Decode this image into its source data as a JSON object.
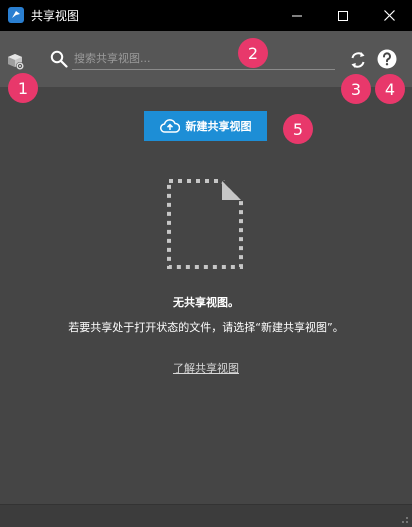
{
  "window": {
    "title": "共享视图"
  },
  "toolbar": {
    "search_placeholder": "搜索共享视图..."
  },
  "badges": [
    "1",
    "2",
    "3",
    "4",
    "5"
  ],
  "main": {
    "new_button_label": "新建共享视图",
    "empty_title": "无共享视图。",
    "empty_description": "若要共享处于打开状态的文件，请选择“新建共享视图”。",
    "learn_link": "了解共享视图"
  },
  "icons": {
    "app": "app-logo-icon",
    "minimize": "minimize-icon",
    "maximize": "maximize-icon",
    "close": "close-icon",
    "settings": "settings-cube-icon",
    "search": "search-icon",
    "refresh": "refresh-icon",
    "help": "help-icon",
    "upload": "cloud-upload-icon",
    "document": "empty-document-icon"
  },
  "colors": {
    "accent": "#1d8ed6",
    "badge": "#e8386b",
    "background": "#454545",
    "toolbar": "#565656",
    "titlebar": "#000000"
  }
}
